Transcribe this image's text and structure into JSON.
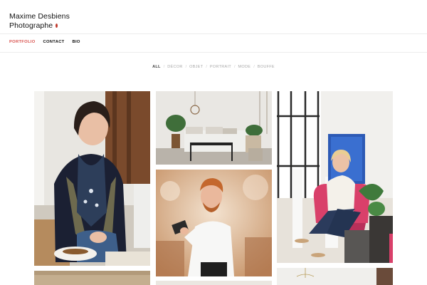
{
  "site": {
    "name_line1": "Maxime Desbiens",
    "name_line2": "Photographe"
  },
  "nav": {
    "items": [
      {
        "label": "PORTFOLIO",
        "active": true
      },
      {
        "label": "CONTACT",
        "active": false
      },
      {
        "label": "BIO",
        "active": false
      }
    ]
  },
  "filters": {
    "items": [
      {
        "label": "ALL",
        "active": true
      },
      {
        "label": "DÉCOR",
        "active": false
      },
      {
        "label": "OBJET",
        "active": false
      },
      {
        "label": "PORTRAIT",
        "active": false
      },
      {
        "label": "MODE",
        "active": false
      },
      {
        "label": "BOUFFE",
        "active": false
      }
    ],
    "separator": "/"
  },
  "colors": {
    "accent": "#d9534f",
    "brand_dot": "#c0392b",
    "text": "#111111",
    "muted": "#aaaaaa"
  }
}
